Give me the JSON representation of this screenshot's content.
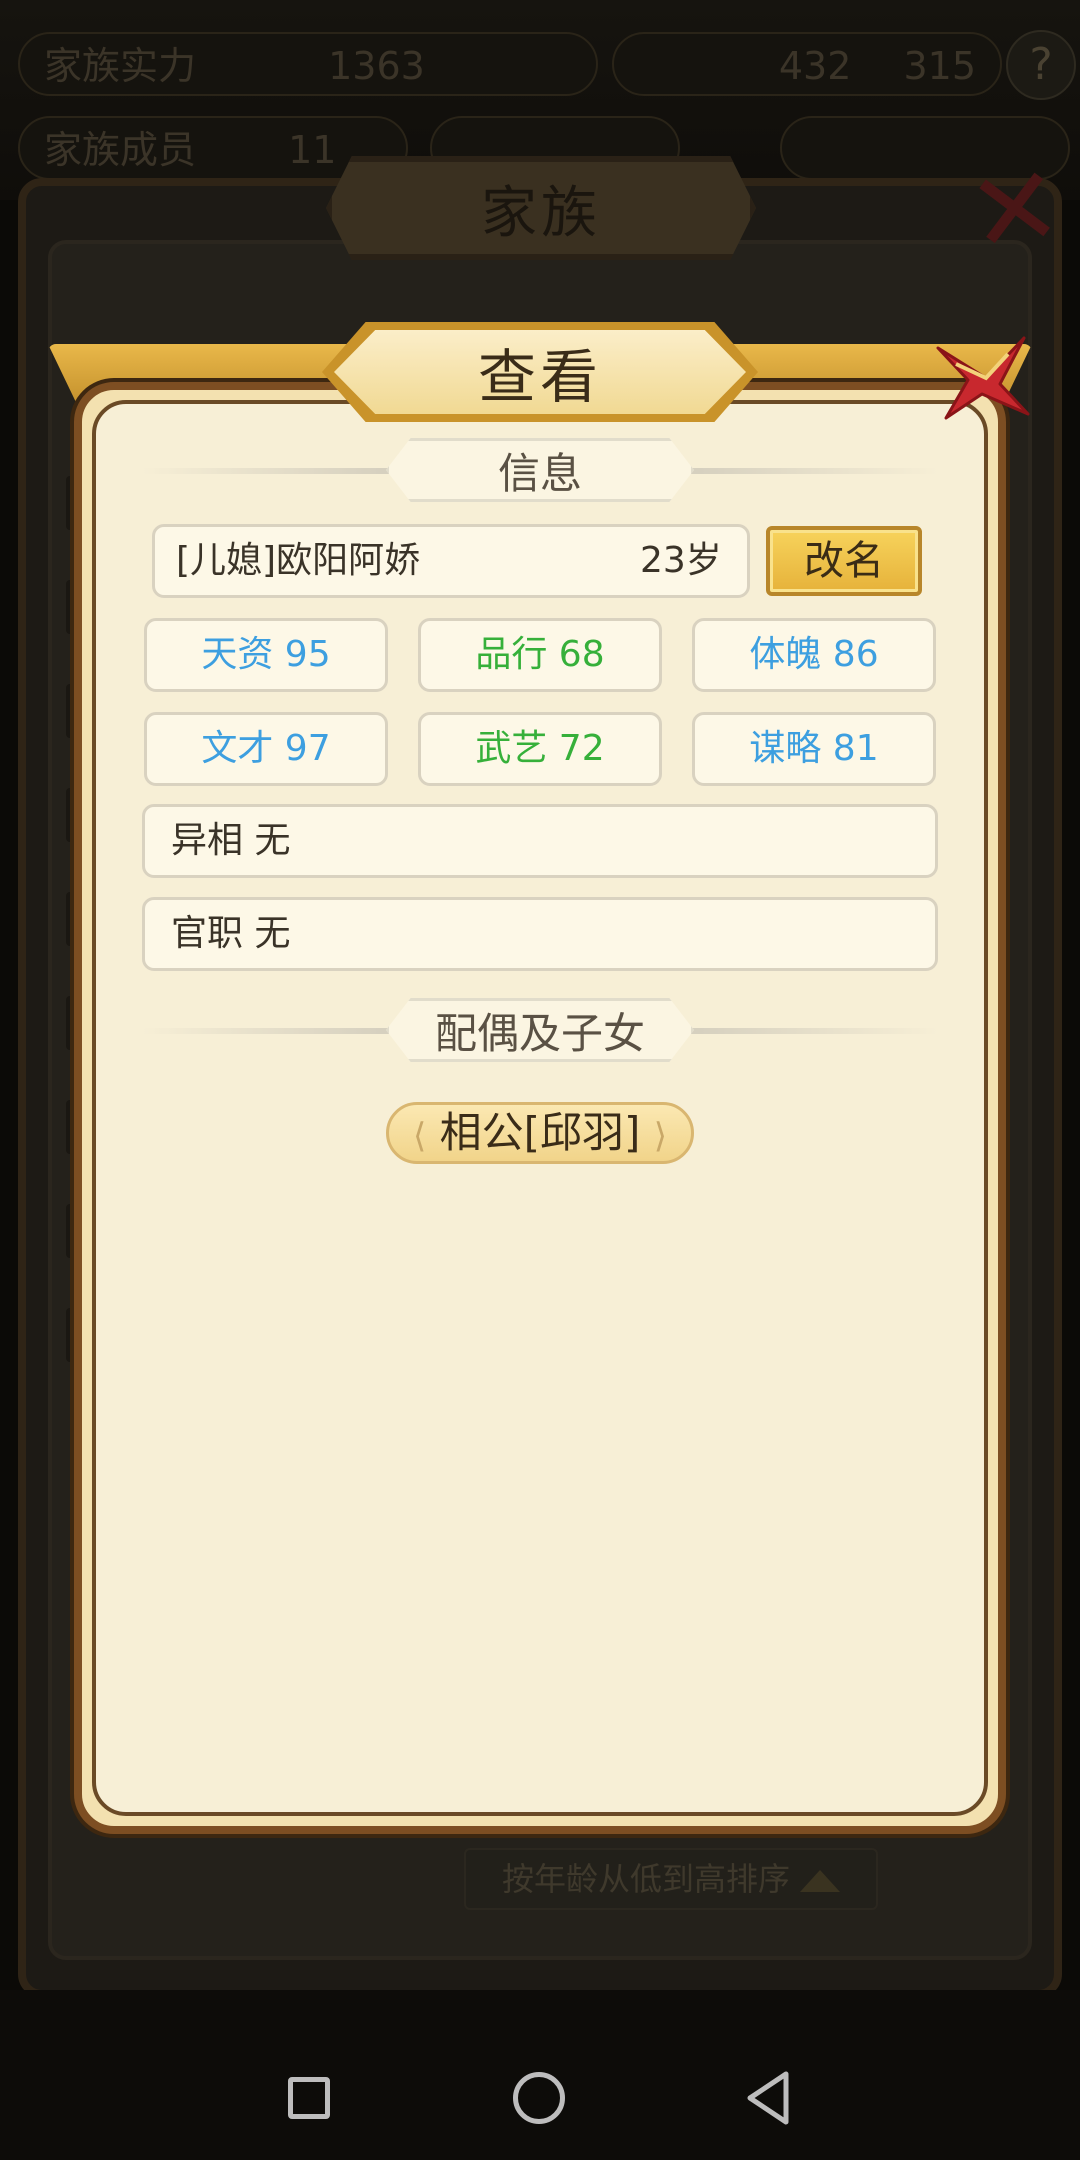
{
  "background": {
    "family_power_label": "家族实力",
    "family_power_value": "1363",
    "resource_a": "432",
    "resource_b": "315",
    "help_label": "?",
    "family_member_label": "家族成员",
    "family_member_value": "11",
    "window_title": "家族",
    "sort_label": "按年龄从低到高排序"
  },
  "dialog": {
    "title": "查看",
    "info_section": "信息",
    "member_name": "[儿媳]欧阳阿娇",
    "member_age": "23岁",
    "rename_button": "改名",
    "stats": [
      {
        "label": "天资 95",
        "color": "#3d9fe0"
      },
      {
        "label": "品行 68",
        "color": "#36b03a"
      },
      {
        "label": "体魄 86",
        "color": "#3d9fe0"
      },
      {
        "label": "文才 97",
        "color": "#3d9fe0"
      },
      {
        "label": "武艺 72",
        "color": "#36b03a"
      },
      {
        "label": "谋略 81",
        "color": "#3d9fe0"
      }
    ],
    "special_trait": "异相 无",
    "official_post": "官职 无",
    "family_section": "配偶及子女",
    "spouse_button": "相公[邱羽]"
  },
  "colors": {
    "accent_gold": "#e6b23a",
    "stat_blue": "#3d9fe0",
    "stat_green": "#36b03a",
    "close_red": "#c8282e"
  }
}
